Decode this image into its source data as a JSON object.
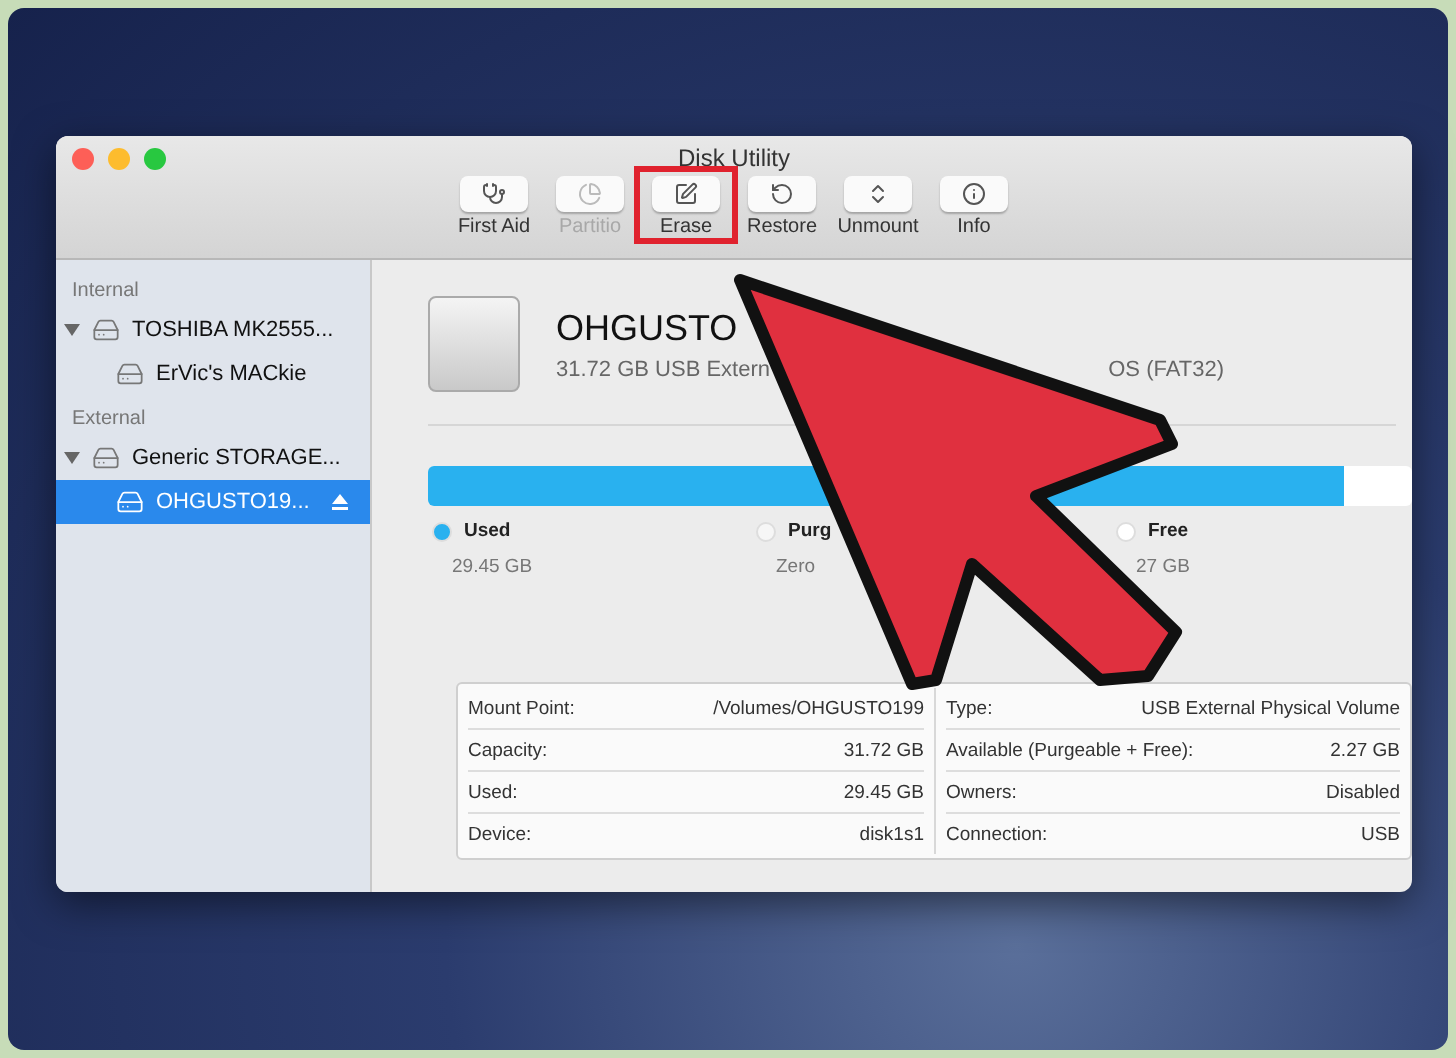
{
  "window": {
    "title": "Disk Utility"
  },
  "toolbar": [
    {
      "kind": "firstaid",
      "label": "First Aid",
      "disabled": false,
      "highlighted": false
    },
    {
      "kind": "partition",
      "label": "Partitio",
      "disabled": true,
      "highlighted": false
    },
    {
      "kind": "erase",
      "label": "Erase",
      "disabled": false,
      "highlighted": true
    },
    {
      "kind": "restore",
      "label": "Restore",
      "disabled": false,
      "highlighted": false
    },
    {
      "kind": "unmount",
      "label": "Unmount",
      "disabled": false,
      "highlighted": false
    },
    {
      "kind": "info",
      "label": "Info",
      "disabled": false,
      "highlighted": false
    }
  ],
  "sidebar": {
    "sections": [
      {
        "heading": "Internal",
        "items": [
          {
            "name": "TOSHIBA MK2555...",
            "expanded": true,
            "selected": false,
            "ejectable": false,
            "children": [
              {
                "name": "ErVic's MACkie",
                "selected": false,
                "ejectable": false
              }
            ]
          }
        ]
      },
      {
        "heading": "External",
        "items": [
          {
            "name": "Generic STORAGE...",
            "expanded": true,
            "selected": false,
            "ejectable": false,
            "children": [
              {
                "name": "OHGUSTO19...",
                "selected": true,
                "ejectable": true
              }
            ]
          }
        ]
      }
    ]
  },
  "volume": {
    "name": "OHGUSTO",
    "subtitle_start": "31.72 GB USB Extern",
    "subtitle_end": "OS (FAT32)"
  },
  "usage": {
    "level": 0.93,
    "legend": [
      {
        "label": "Used",
        "value": "29.45 GB",
        "color": "#29b1ef"
      },
      {
        "label": "Purg",
        "value": "Zero",
        "color": "#f6f6f6"
      },
      {
        "label": "Free",
        "value": "27 GB",
        "color": "#ffffff"
      }
    ]
  },
  "info": {
    "left": [
      {
        "label": "Mount Point:",
        "value": "/Volumes/OHGUSTO199"
      },
      {
        "label": "Capacity:",
        "value": "31.72 GB"
      },
      {
        "label": "Used:",
        "value": "29.45 GB"
      },
      {
        "label": "Device:",
        "value": "disk1s1"
      }
    ],
    "right": [
      {
        "label": "Type:",
        "value": "USB External Physical Volume"
      },
      {
        "label": "Available (Purgeable + Free):",
        "value": "2.27 GB"
      },
      {
        "label": "Owners:",
        "value": "Disabled"
      },
      {
        "label": "Connection:",
        "value": "USB"
      }
    ]
  }
}
